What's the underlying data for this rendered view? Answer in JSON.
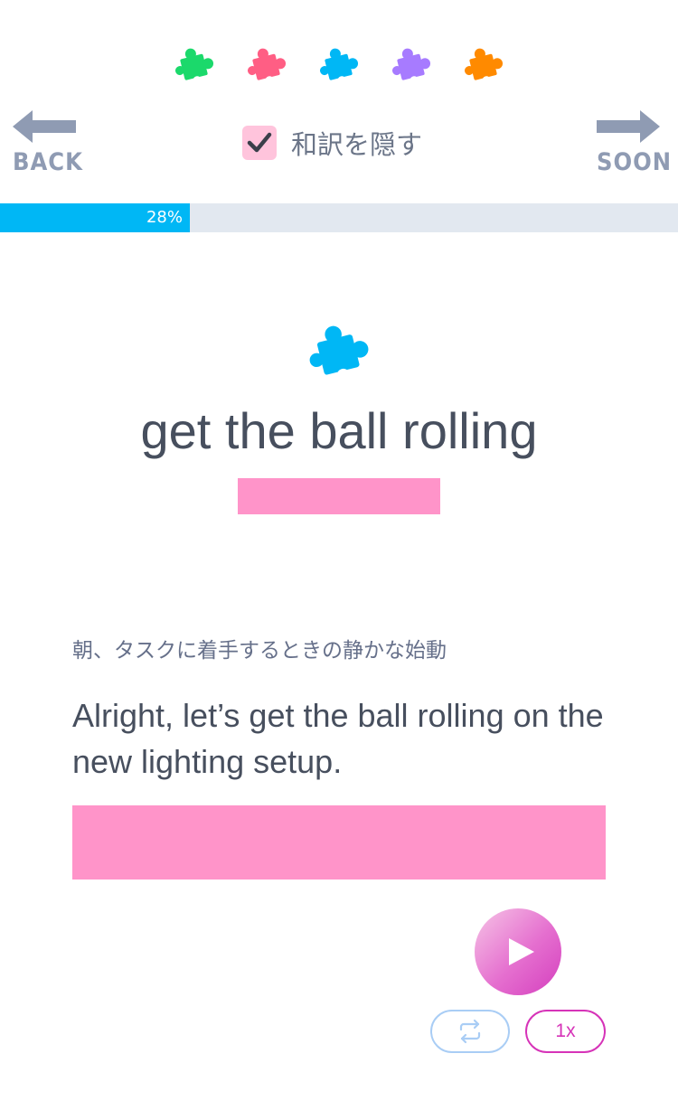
{
  "colors": {
    "puzzle_colors": [
      "#1bd96b",
      "#ff5e84",
      "#00b7f5",
      "#a77bff",
      "#ff8a00"
    ],
    "accent_pink": "#ff94c9",
    "progress_fill": "#00b7f5",
    "arrow_gray": "#8f9bb3"
  },
  "header": {
    "puzzles": [
      {
        "icon": "puzzle-piece-icon",
        "color": "#1bd96b"
      },
      {
        "icon": "puzzle-piece-icon",
        "color": "#ff5e84"
      },
      {
        "icon": "puzzle-piece-icon",
        "color": "#00b7f5"
      },
      {
        "icon": "puzzle-piece-icon",
        "color": "#a77bff"
      },
      {
        "icon": "puzzle-piece-icon",
        "color": "#ff8a00"
      }
    ],
    "back_label": "BACK",
    "soon_label": "SOON",
    "toggle": {
      "label": "和訳を隠す",
      "checked": true
    }
  },
  "progress": {
    "percent": 28,
    "label": "28%"
  },
  "card": {
    "icon": {
      "name": "puzzle-piece-icon",
      "color": "#00b7f5"
    },
    "phrase": "get the ball rolling",
    "japanese_caption": "朝、タスクに着手するときの静かな始動",
    "example": "Alright, let’s get the ball rolling on the new lighting setup."
  },
  "audio": {
    "play_icon": "play-icon",
    "repeat_icon": "repeat-icon",
    "speed_label": "1x"
  }
}
